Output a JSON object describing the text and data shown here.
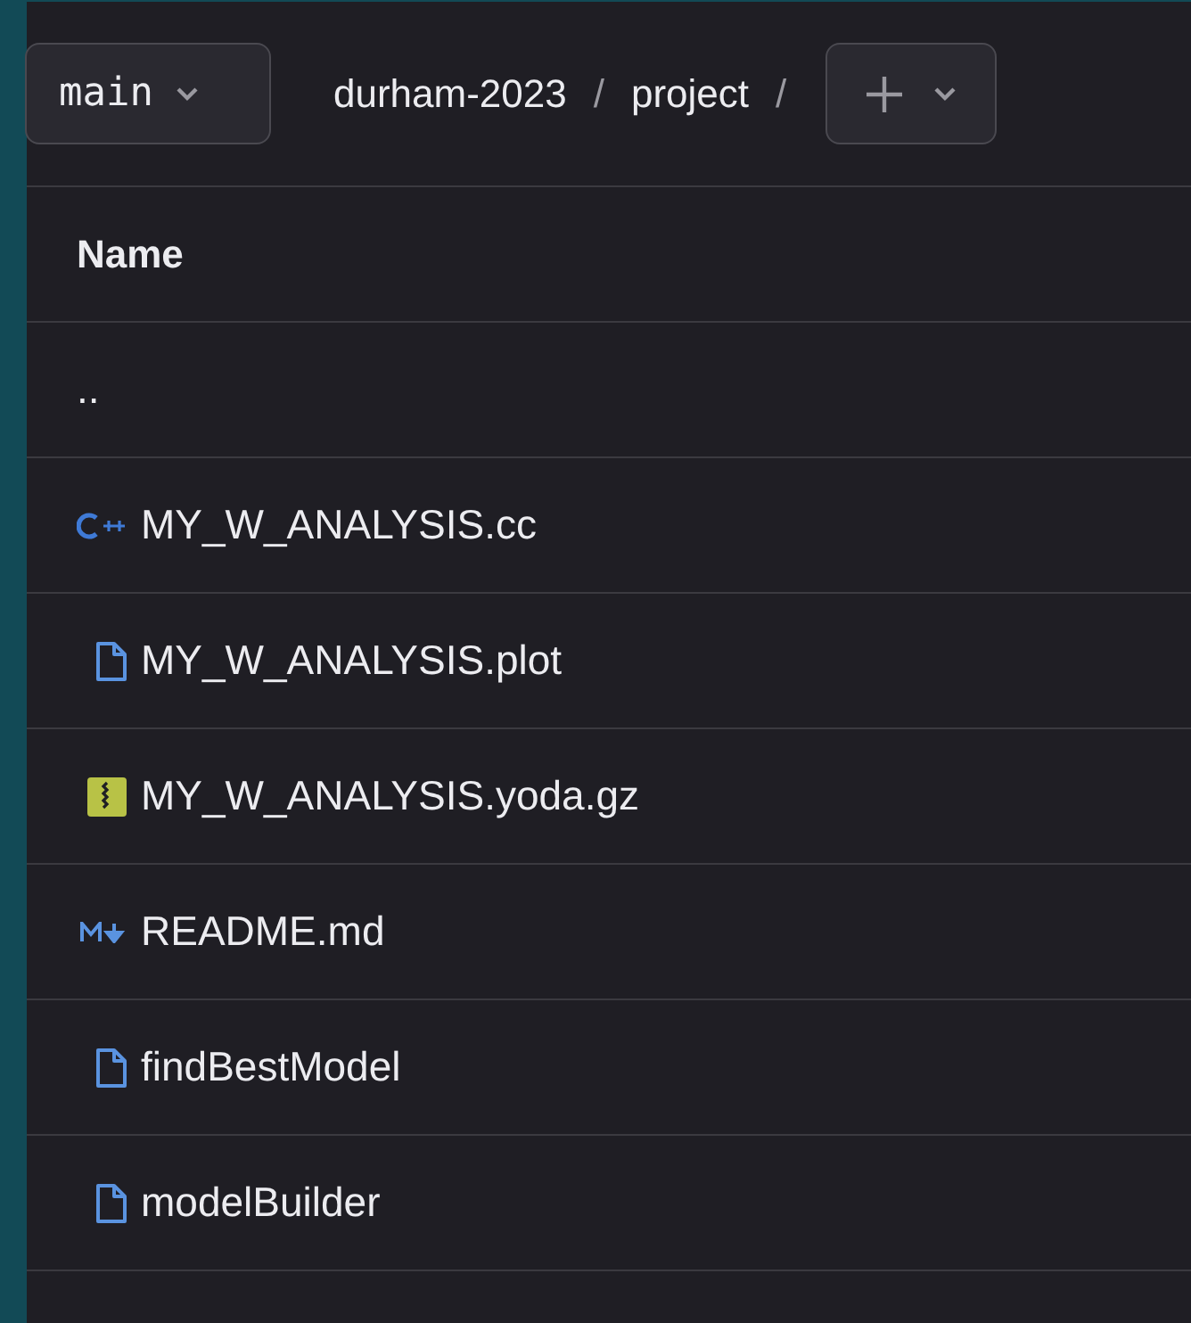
{
  "branch": {
    "label": "main"
  },
  "breadcrumb": [
    "durham-2023",
    "/",
    "project",
    "/"
  ],
  "table": {
    "columns": [
      "Name"
    ],
    "rows": [
      {
        "kind": "parent",
        "name": ".."
      },
      {
        "kind": "cpp",
        "name": "MY_W_ANALYSIS.cc"
      },
      {
        "kind": "file",
        "name": "MY_W_ANALYSIS.plot"
      },
      {
        "kind": "archive",
        "name": "MY_W_ANALYSIS.yoda.gz"
      },
      {
        "kind": "markdown",
        "name": "README.md"
      },
      {
        "kind": "file",
        "name": "findBestModel"
      },
      {
        "kind": "file",
        "name": "modelBuilder"
      }
    ]
  }
}
